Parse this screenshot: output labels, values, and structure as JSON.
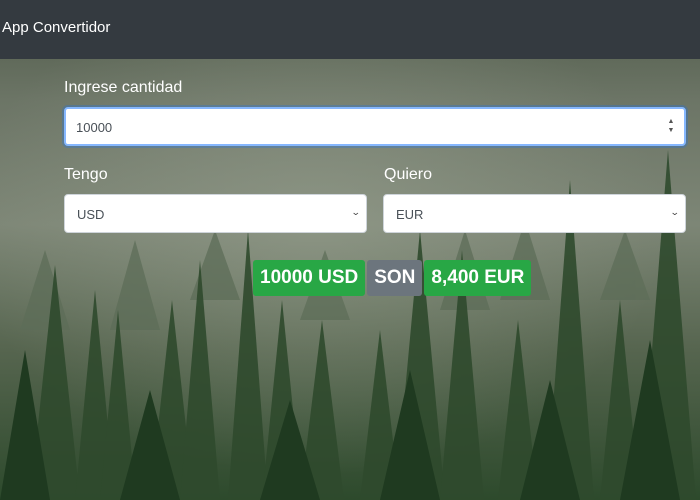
{
  "app": {
    "title": "App Convertidor"
  },
  "form": {
    "amount_label": "Ingrese cantidad",
    "amount_value": "10000",
    "have_label": "Tengo",
    "have_value": "USD",
    "want_label": "Quiero",
    "want_value": "EUR"
  },
  "result": {
    "from": "10000 USD",
    "connector": "SON",
    "to": "8,400 EUR"
  },
  "colors": {
    "navbar": "#343a40",
    "success": "#28a745",
    "secondary": "#6c757d",
    "focus_border": "#86b7fe"
  },
  "icons": {
    "spinner": "number-spinner-icon",
    "select": "chevron-down-icon"
  }
}
